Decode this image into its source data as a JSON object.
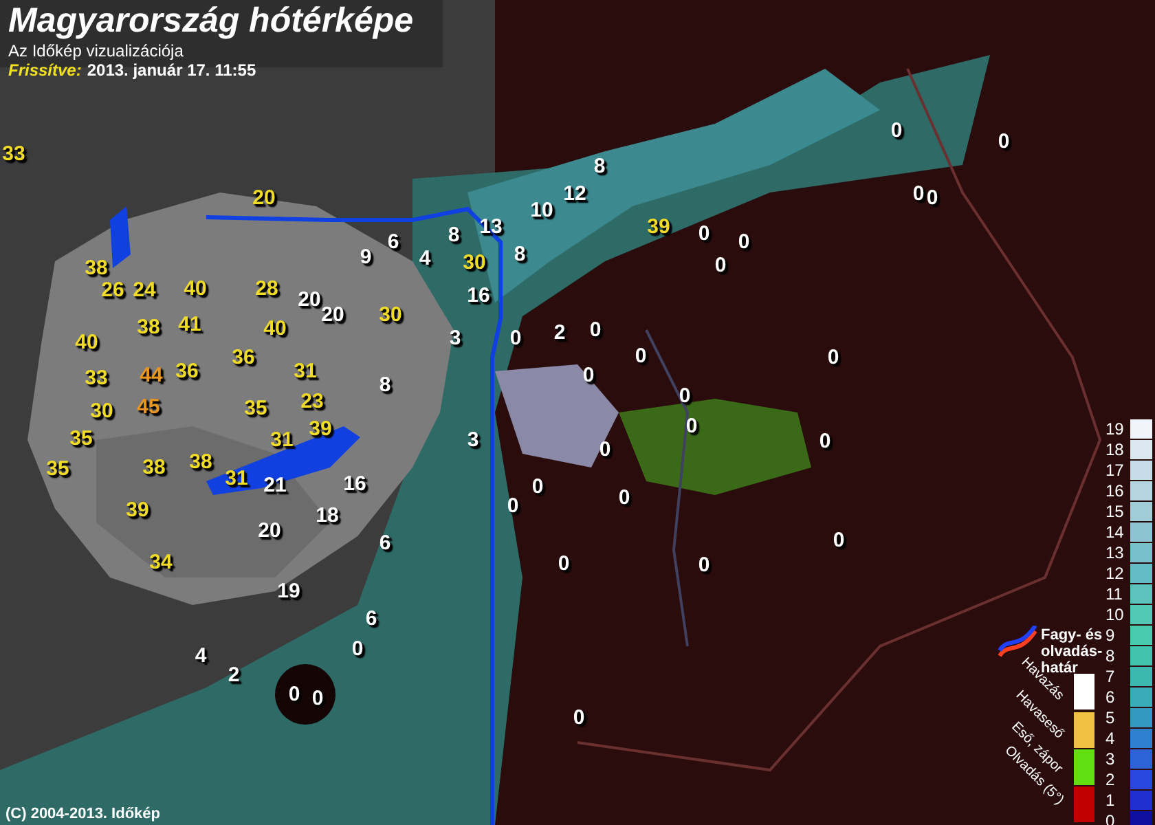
{
  "header": {
    "title": "Magyarország hótérképe",
    "subtitle": "Az Időkép vizualizációja",
    "updated_label": "Frissítve:",
    "updated_value": "2013. január 17. 11:55"
  },
  "map_values": [
    {
      "value": "33",
      "color": "#f0dc28"
    },
    {
      "value": "20",
      "color": "#f0dc28"
    },
    {
      "value": "38",
      "color": "#f0dc28"
    },
    {
      "value": "26",
      "color": "#f0dc28"
    },
    {
      "value": "24",
      "color": "#f0dc28"
    },
    {
      "value": "40",
      "color": "#f0dc28"
    },
    {
      "value": "28",
      "color": "#f0dc28"
    },
    {
      "value": "20",
      "color": "#ffffff"
    },
    {
      "value": "20",
      "color": "#ffffff"
    },
    {
      "value": "30",
      "color": "#f0dc28"
    },
    {
      "value": "38",
      "color": "#f0dc28"
    },
    {
      "value": "41",
      "color": "#f0dc28"
    },
    {
      "value": "40",
      "color": "#f0dc28"
    },
    {
      "value": "40",
      "color": "#f0dc28"
    },
    {
      "value": "36",
      "color": "#f0dc28"
    },
    {
      "value": "33",
      "color": "#f0dc28"
    },
    {
      "value": "44",
      "color": "#e8961e"
    },
    {
      "value": "36",
      "color": "#f0dc28"
    },
    {
      "value": "31",
      "color": "#f0dc28"
    },
    {
      "value": "8",
      "color": "#ffffff"
    },
    {
      "value": "45",
      "color": "#e8961e"
    },
    {
      "value": "35",
      "color": "#f0dc28"
    },
    {
      "value": "23",
      "color": "#f0dc28"
    },
    {
      "value": "30",
      "color": "#f0dc28"
    },
    {
      "value": "39",
      "color": "#f0dc28"
    },
    {
      "value": "35",
      "color": "#f0dc28"
    },
    {
      "value": "31",
      "color": "#f0dc28"
    },
    {
      "value": "35",
      "color": "#f0dc28"
    },
    {
      "value": "38",
      "color": "#f0dc28"
    },
    {
      "value": "38",
      "color": "#f0dc28"
    },
    {
      "value": "31",
      "color": "#f0dc28"
    },
    {
      "value": "21",
      "color": "#ffffff"
    },
    {
      "value": "16",
      "color": "#ffffff"
    },
    {
      "value": "39",
      "color": "#f0dc28"
    },
    {
      "value": "18",
      "color": "#ffffff"
    },
    {
      "value": "20",
      "color": "#ffffff"
    },
    {
      "value": "6",
      "color": "#ffffff"
    },
    {
      "value": "34",
      "color": "#f0dc28"
    },
    {
      "value": "19",
      "color": "#ffffff"
    },
    {
      "value": "6",
      "color": "#ffffff"
    },
    {
      "value": "4",
      "color": "#ffffff"
    },
    {
      "value": "0",
      "color": "#ffffff"
    },
    {
      "value": "2",
      "color": "#ffffff"
    },
    {
      "value": "0",
      "color": "#ffffff"
    },
    {
      "value": "0",
      "color": "#ffffff"
    },
    {
      "value": "0",
      "color": "#ffffff"
    },
    {
      "value": "8",
      "color": "#ffffff"
    },
    {
      "value": "12",
      "color": "#ffffff"
    },
    {
      "value": "10",
      "color": "#ffffff"
    },
    {
      "value": "13",
      "color": "#ffffff"
    },
    {
      "value": "8",
      "color": "#ffffff"
    },
    {
      "value": "6",
      "color": "#ffffff"
    },
    {
      "value": "9",
      "color": "#ffffff"
    },
    {
      "value": "4",
      "color": "#ffffff"
    },
    {
      "value": "30",
      "color": "#f0dc28"
    },
    {
      "value": "8",
      "color": "#ffffff"
    },
    {
      "value": "39",
      "color": "#f0dc28"
    },
    {
      "value": "0",
      "color": "#ffffff"
    },
    {
      "value": "0",
      "color": "#ffffff"
    },
    {
      "value": "0",
      "color": "#ffffff"
    },
    {
      "value": "16",
      "color": "#ffffff"
    },
    {
      "value": "3",
      "color": "#ffffff"
    },
    {
      "value": "0",
      "color": "#ffffff"
    },
    {
      "value": "2",
      "color": "#ffffff"
    },
    {
      "value": "0",
      "color": "#ffffff"
    },
    {
      "value": "0",
      "color": "#ffffff"
    },
    {
      "value": "0",
      "color": "#ffffff"
    },
    {
      "value": "0",
      "color": "#ffffff"
    },
    {
      "value": "0",
      "color": "#ffffff"
    },
    {
      "value": "0",
      "color": "#ffffff"
    },
    {
      "value": "3",
      "color": "#ffffff"
    },
    {
      "value": "0",
      "color": "#ffffff"
    },
    {
      "value": "0",
      "color": "#ffffff"
    },
    {
      "value": "0",
      "color": "#ffffff"
    },
    {
      "value": "0",
      "color": "#ffffff"
    },
    {
      "value": "0",
      "color": "#ffffff"
    },
    {
      "value": "0",
      "color": "#ffffff"
    },
    {
      "value": "0",
      "color": "#ffffff"
    },
    {
      "value": "0",
      "color": "#ffffff"
    },
    {
      "value": "0",
      "color": "#ffffff"
    },
    {
      "value": "0",
      "color": "#ffffff"
    },
    {
      "value": "0",
      "color": "#ffffff"
    },
    {
      "value": "0",
      "color": "#ffffff"
    }
  ],
  "frost_legend": {
    "label": "Fagy- és olvadás-határ"
  },
  "precip_legend": [
    {
      "label": "Havazás",
      "color": "#ffffff"
    },
    {
      "label": "Havaseső",
      "color": "#f0c040"
    },
    {
      "label": "Eső, zápor",
      "color": "#60e010"
    },
    {
      "label": "Olvadás (5°)",
      "color": "#c00000"
    }
  ],
  "depth_scale": [
    {
      "label": "19",
      "color": "#f0f4f8"
    },
    {
      "label": "18",
      "color": "#dce8f0"
    },
    {
      "label": "17",
      "color": "#c8dce8"
    },
    {
      "label": "16",
      "color": "#b4d4e0"
    },
    {
      "label": "15",
      "color": "#a0ccd8"
    },
    {
      "label": "14",
      "color": "#8cc4d4"
    },
    {
      "label": "13",
      "color": "#78c0cc"
    },
    {
      "label": "12",
      "color": "#64bcc4"
    },
    {
      "label": "11",
      "color": "#5cc4bc"
    },
    {
      "label": "10",
      "color": "#50c8b4"
    },
    {
      "label": "9",
      "color": "#48ccb0"
    },
    {
      "label": "8",
      "color": "#40c4b0"
    },
    {
      "label": "7",
      "color": "#3cb8b0"
    },
    {
      "label": "6",
      "color": "#38acb8"
    },
    {
      "label": "5",
      "color": "#3498c0"
    },
    {
      "label": "4",
      "color": "#3080d0"
    },
    {
      "label": "3",
      "color": "#2c64d8"
    },
    {
      "label": "2",
      "color": "#2848e0"
    },
    {
      "label": "1",
      "color": "#2030d0"
    },
    {
      "label": "0",
      "color": "#1010a0"
    }
  ],
  "copyright": "(C) 2004-2013. Időkép"
}
